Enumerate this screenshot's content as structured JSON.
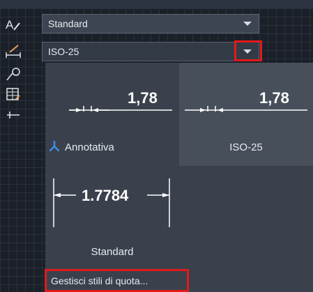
{
  "combos": {
    "text_style": {
      "value": "Standard"
    },
    "dim_style": {
      "value": "ISO-25"
    }
  },
  "tool_icons": [
    "text-style-icon",
    "dimension-style-icon",
    "multileader-style-icon",
    "table-style-icon",
    "leader-icon"
  ],
  "gallery": {
    "tiles": [
      {
        "name": "Annotativa",
        "dim_value": "1,78",
        "annotative": true
      },
      {
        "name": "ISO-25",
        "dim_value": "1,78",
        "selected": true
      },
      {
        "name": "Standard",
        "dim_value": "1.7784"
      }
    ]
  },
  "footer": {
    "manage_label": "Gestisci stili di quota..."
  },
  "colors": {
    "highlight": "#e21a1a",
    "panel": "#3a414c",
    "selected_tile": "#474f5b",
    "annotative_icon": "#3d8ee8"
  }
}
